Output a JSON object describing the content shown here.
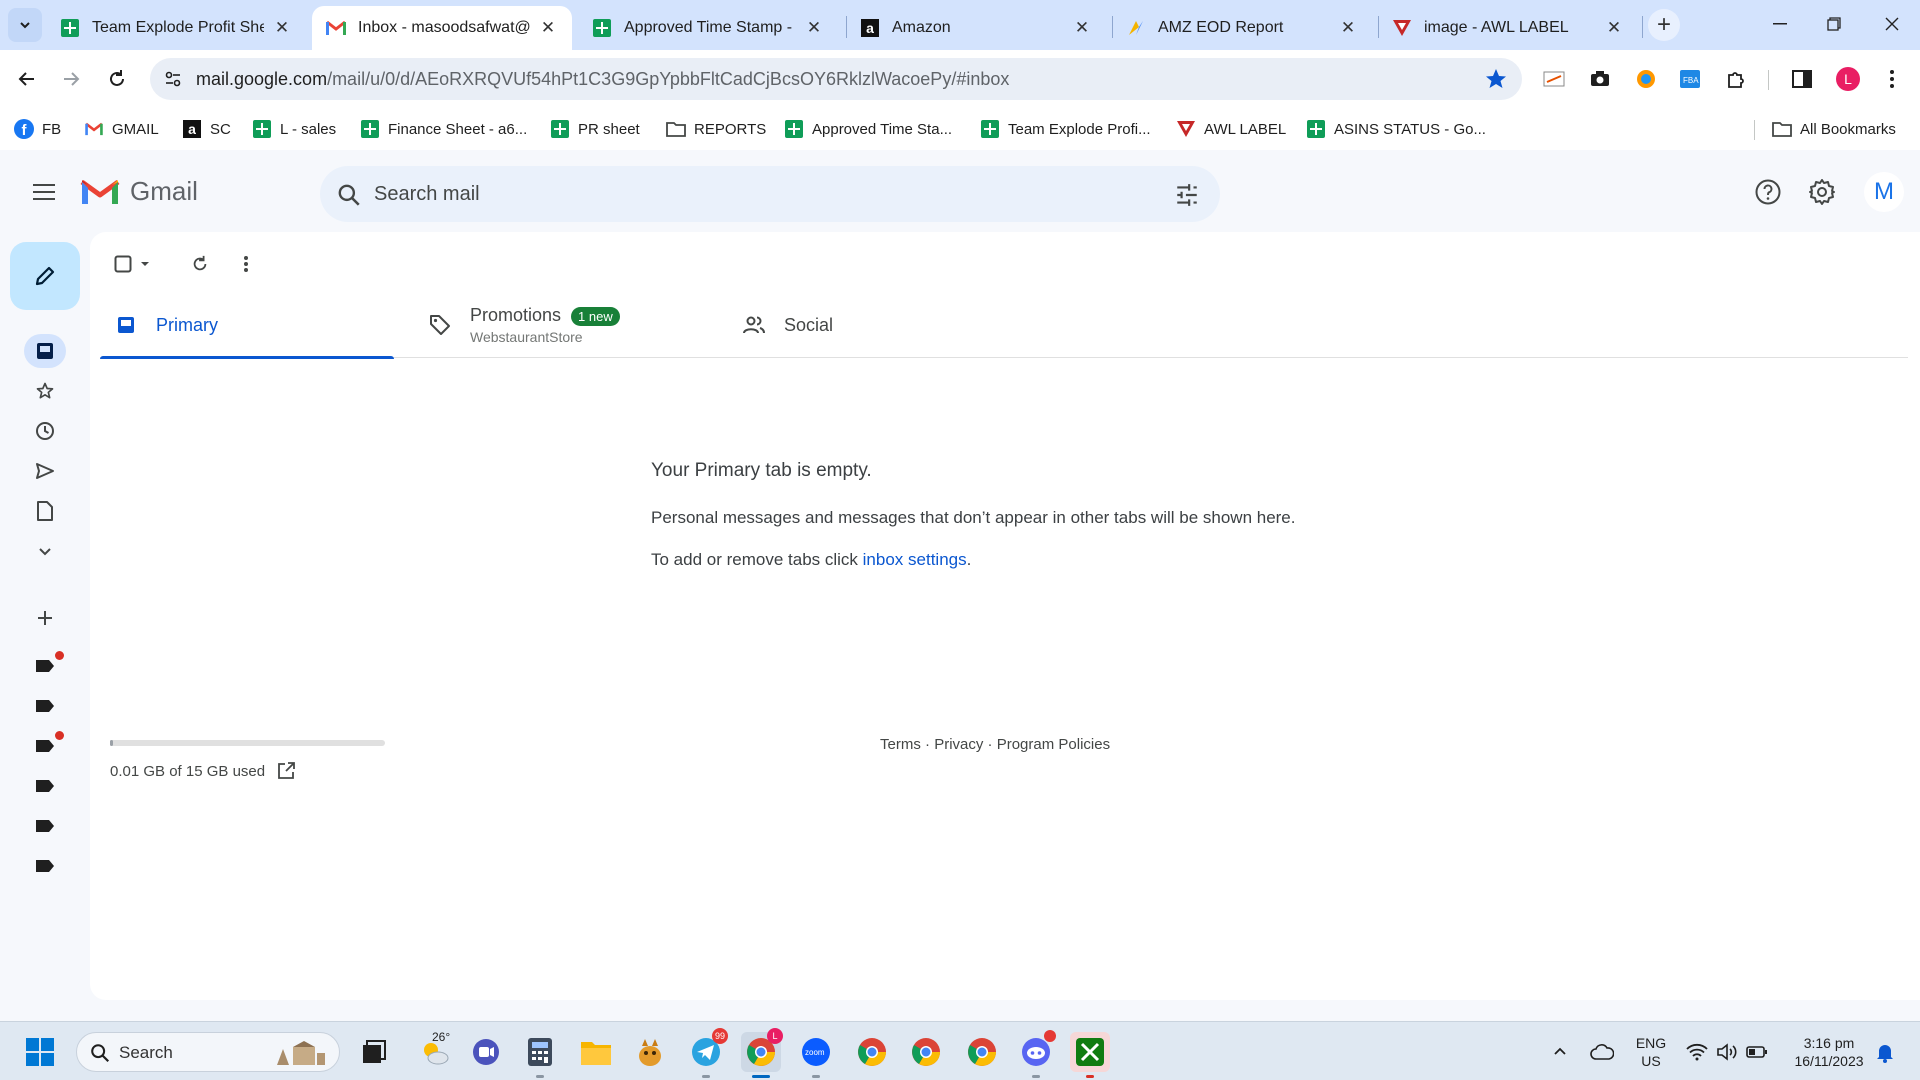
{
  "browser": {
    "tabs": [
      {
        "title": "Team Explode Profit Sheet",
        "icon": "sheets-icon"
      },
      {
        "title": "Inbox - masoodsafwat@gmail.com",
        "icon": "gmail-icon",
        "active": true
      },
      {
        "title": "Approved Time Stamp - Google Sheets",
        "icon": "sheets-icon"
      },
      {
        "title": "Amazon",
        "icon": "amazon-icon"
      },
      {
        "title": "AMZ EOD Report",
        "icon": "report-icon"
      },
      {
        "title": "image - AWL LABEL",
        "icon": "awl-icon"
      }
    ],
    "url_main": "mail.google.com",
    "url_rest": "/mail/u/0/d/AEoRXRQVUf54hPt1C3G9GpYpbbFltCadCjBcsOY6RklzlWacoePy/#inbox",
    "profile_letter": "L",
    "bookmarks": [
      "FB",
      "GMAIL",
      "SC",
      "L - sales",
      "Finance Sheet - a6...",
      "PR sheet",
      "REPORTS",
      "Approved Time Sta...",
      "Team Explode Profi...",
      "AWL LABEL",
      "ASINS STATUS - Go..."
    ],
    "all_bookmarks": "All Bookmarks"
  },
  "gmail": {
    "logo_text": "Gmail",
    "search_placeholder": "Search mail",
    "avatar_letter": "M",
    "tabs": {
      "primary": "Primary",
      "promotions": "Promotions",
      "promotions_badge": "1 new",
      "promotions_sub": "WebstaurantStore",
      "social": "Social"
    },
    "empty": {
      "heading": "Your Primary tab is empty.",
      "line1": "Personal messages and messages that don’t appear in other tabs will be shown here.",
      "line2_prefix": "To add or remove tabs click ",
      "line2_link": "inbox settings",
      "line2_suffix": "."
    },
    "storage_text": "0.01 GB of 15 GB used",
    "storage_fraction": 0.001,
    "footer": {
      "terms": "Terms",
      "privacy": "Privacy",
      "policies": "Program Policies",
      "sep": " · "
    }
  },
  "taskbar": {
    "search_label": "Search",
    "weather_temp": "26°",
    "telegram_badge": "99",
    "chrome_badge": "L",
    "lang_top": "ENG",
    "lang_bottom": "US",
    "time": "3:16 pm",
    "date": "16/11/2023"
  },
  "colors": {
    "accent": "#0b57d0",
    "compose": "#c2e7ff",
    "badge_green": "#188038",
    "tabstrip": "#d3e3fd"
  }
}
